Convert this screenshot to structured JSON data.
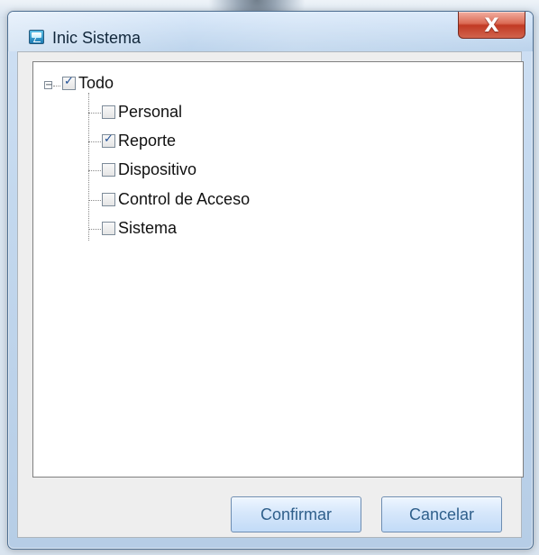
{
  "window": {
    "title": "Inic Sistema",
    "close_label": "X"
  },
  "tree": {
    "root": {
      "label": "Todo",
      "checked": true,
      "expanded": true
    },
    "items": [
      {
        "label": "Personal",
        "checked": false
      },
      {
        "label": "Reporte",
        "checked": true
      },
      {
        "label": "Dispositivo",
        "checked": false
      },
      {
        "label": "Control de Acceso",
        "checked": false
      },
      {
        "label": "Sistema",
        "checked": false
      }
    ]
  },
  "buttons": {
    "confirm": "Confirmar",
    "cancel": "Cancelar"
  },
  "icons": {
    "app": "app-window-icon",
    "close": "close-icon",
    "expander": "minus-icon"
  }
}
